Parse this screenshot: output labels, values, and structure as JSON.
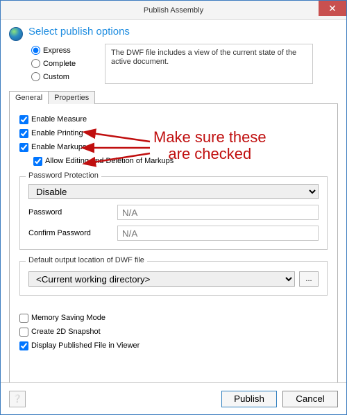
{
  "window": {
    "title": "Publish Assembly"
  },
  "header": {
    "title": "Select publish options",
    "radios": [
      {
        "value": "express",
        "label": "Express",
        "checked": true
      },
      {
        "value": "complete",
        "label": "Complete",
        "checked": false
      },
      {
        "value": "custom",
        "label": "Custom",
        "checked": false
      }
    ],
    "description": "The DWF file includes a view of the current state of the active document."
  },
  "tabs": [
    {
      "id": "general",
      "label": "General",
      "active": true
    },
    {
      "id": "properties",
      "label": "Properties",
      "active": false
    }
  ],
  "general": {
    "enable_measure": {
      "label": "Enable Measure",
      "checked": true
    },
    "enable_printing": {
      "label": "Enable Printing",
      "checked": true
    },
    "enable_markups": {
      "label": "Enable Markups",
      "checked": true
    },
    "allow_edit_markups": {
      "label": "Allow Editing and Deletion of Markups",
      "checked": true
    },
    "password_section": {
      "legend": "Password Protection",
      "protection_value": "Disable",
      "password_label": "Password",
      "password_placeholder": "N/A",
      "confirm_label": "Confirm Password",
      "confirm_placeholder": "N/A"
    },
    "output_section": {
      "legend": "Default output location of DWF file",
      "location_value": "<Current working directory>",
      "browse_label": "..."
    },
    "memory_saving": {
      "label": "Memory Saving Mode",
      "checked": false
    },
    "create_snapshot": {
      "label": "Create 2D Snapshot",
      "checked": false
    },
    "display_published": {
      "label": "Display Published File in Viewer",
      "checked": true
    }
  },
  "footer": {
    "publish": "Publish",
    "cancel": "Cancel"
  },
  "annotation": {
    "text_line1": "Make sure these",
    "text_line2": "are checked"
  }
}
